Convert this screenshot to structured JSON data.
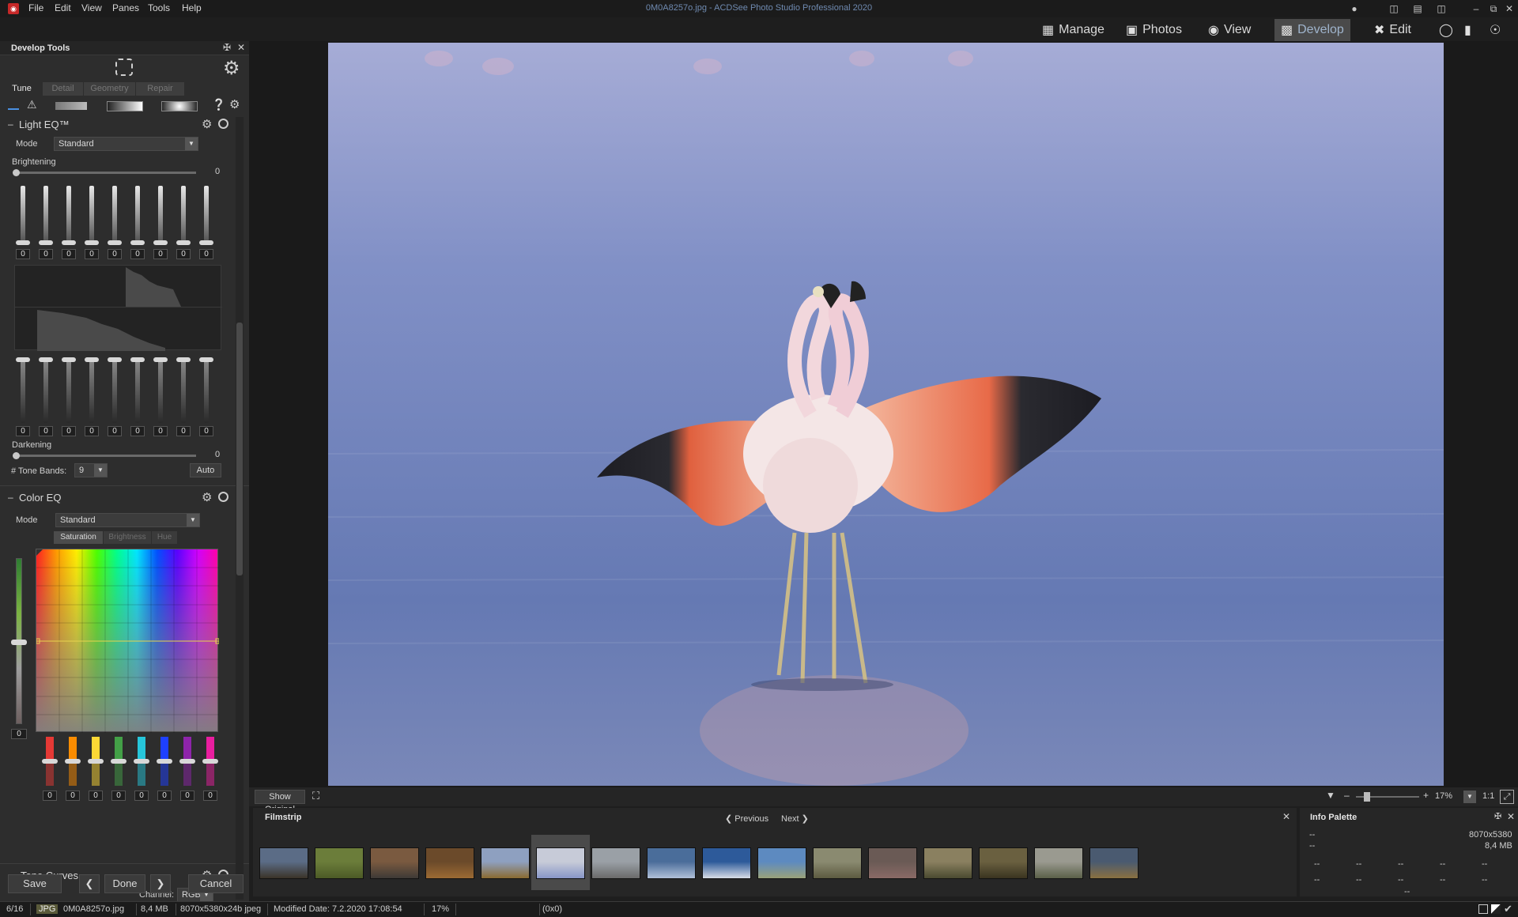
{
  "window": {
    "title": "0M0A8257o.jpg - ACDSee Photo Studio Professional 2020",
    "menu": [
      "File",
      "Edit",
      "View",
      "Panes",
      "Tools",
      "Help"
    ]
  },
  "modes": [
    {
      "label": "Manage",
      "icon": "grid-icon"
    },
    {
      "label": "Photos",
      "icon": "photos-icon"
    },
    {
      "label": "View",
      "icon": "eye-icon"
    },
    {
      "label": "Develop",
      "icon": "develop-icon"
    },
    {
      "label": "Edit",
      "icon": "edit-icon"
    }
  ],
  "develop_tools": {
    "title": "Develop Tools",
    "tabs": [
      "Tune",
      "Detail",
      "Geometry",
      "Repair"
    ],
    "light_eq": {
      "title": "Light EQ™",
      "mode_label": "Mode",
      "mode_value": "Standard",
      "brightening_label": "Brightening",
      "brightening_value": "0",
      "band_values_top": [
        "0",
        "0",
        "0",
        "0",
        "0",
        "0",
        "0",
        "0",
        "0"
      ],
      "band_values_bottom": [
        "0",
        "0",
        "0",
        "0",
        "0",
        "0",
        "0",
        "0",
        "0"
      ],
      "darkening_label": "Darkening",
      "darkening_value": "0",
      "tone_bands_label": "# Tone Bands:",
      "tone_bands_value": "9",
      "auto_label": "Auto"
    },
    "color_eq": {
      "title": "Color EQ",
      "mode_label": "Mode",
      "mode_value": "Standard",
      "subtabs": [
        "Saturation",
        "Brightness",
        "Hue"
      ],
      "level_value": "0",
      "band_colors": [
        "#e53935",
        "#fb8c00",
        "#fdd835",
        "#43a047",
        "#26c6da",
        "#1e40ff",
        "#8e24aa",
        "#e91e9f"
      ],
      "band_values": [
        "0",
        "0",
        "0",
        "0",
        "0",
        "0",
        "0",
        "0"
      ]
    },
    "tone_curves": {
      "title": "Tone Curves",
      "channel_label": "Channel:",
      "channel_value": "RGB"
    },
    "buttons": {
      "save": "Save",
      "done": "Done",
      "cancel": "Cancel"
    }
  },
  "viewer": {
    "show_original": "Show Original",
    "zoom": "17%",
    "one_to_one": "1:1"
  },
  "filmstrip": {
    "title": "Filmstrip",
    "previous": "Previous",
    "next": "Next",
    "thumb_colors": [
      [
        "#5b6c86",
        "#3b3328"
      ],
      [
        "#6b7d3a",
        "#4c5a26"
      ],
      [
        "#7a5a40",
        "#3e3a36"
      ],
      [
        "#6b4a2a",
        "#9c6a33"
      ],
      [
        "#8ea0c0",
        "#8a6a30"
      ],
      [
        "#c7cbd8",
        "#8796c7"
      ],
      [
        "#9aa0a6",
        "#6a6a6a"
      ],
      [
        "#4a6d9a",
        "#b0c0d8"
      ],
      [
        "#2d5a9a",
        "#d8dde6"
      ],
      [
        "#5d8ac0",
        "#9aa27a"
      ],
      [
        "#8a8a70",
        "#5c5a40"
      ],
      [
        "#6a5a55",
        "#8a6a66"
      ],
      [
        "#8a8060",
        "#4a4a30"
      ],
      [
        "#6a6040",
        "#3a3420"
      ],
      [
        "#9a9a90",
        "#5a6048"
      ],
      [
        "#4a5a70",
        "#8a7040"
      ]
    ],
    "selected_index": 5
  },
  "info_palette": {
    "title": "Info Palette",
    "dims": "8070x5380",
    "size": "8,4 MB",
    "placeholder": "--"
  },
  "status": {
    "position": "6/16",
    "type": "JPG",
    "filename": "0M0A8257o.jpg",
    "filesize": "8,4 MB",
    "dimensions": "8070x5380x24b jpeg",
    "modified": "Modified Date: 7.2.2020 17:08:54",
    "zoom": "17%",
    "coords": "(0x0)"
  }
}
